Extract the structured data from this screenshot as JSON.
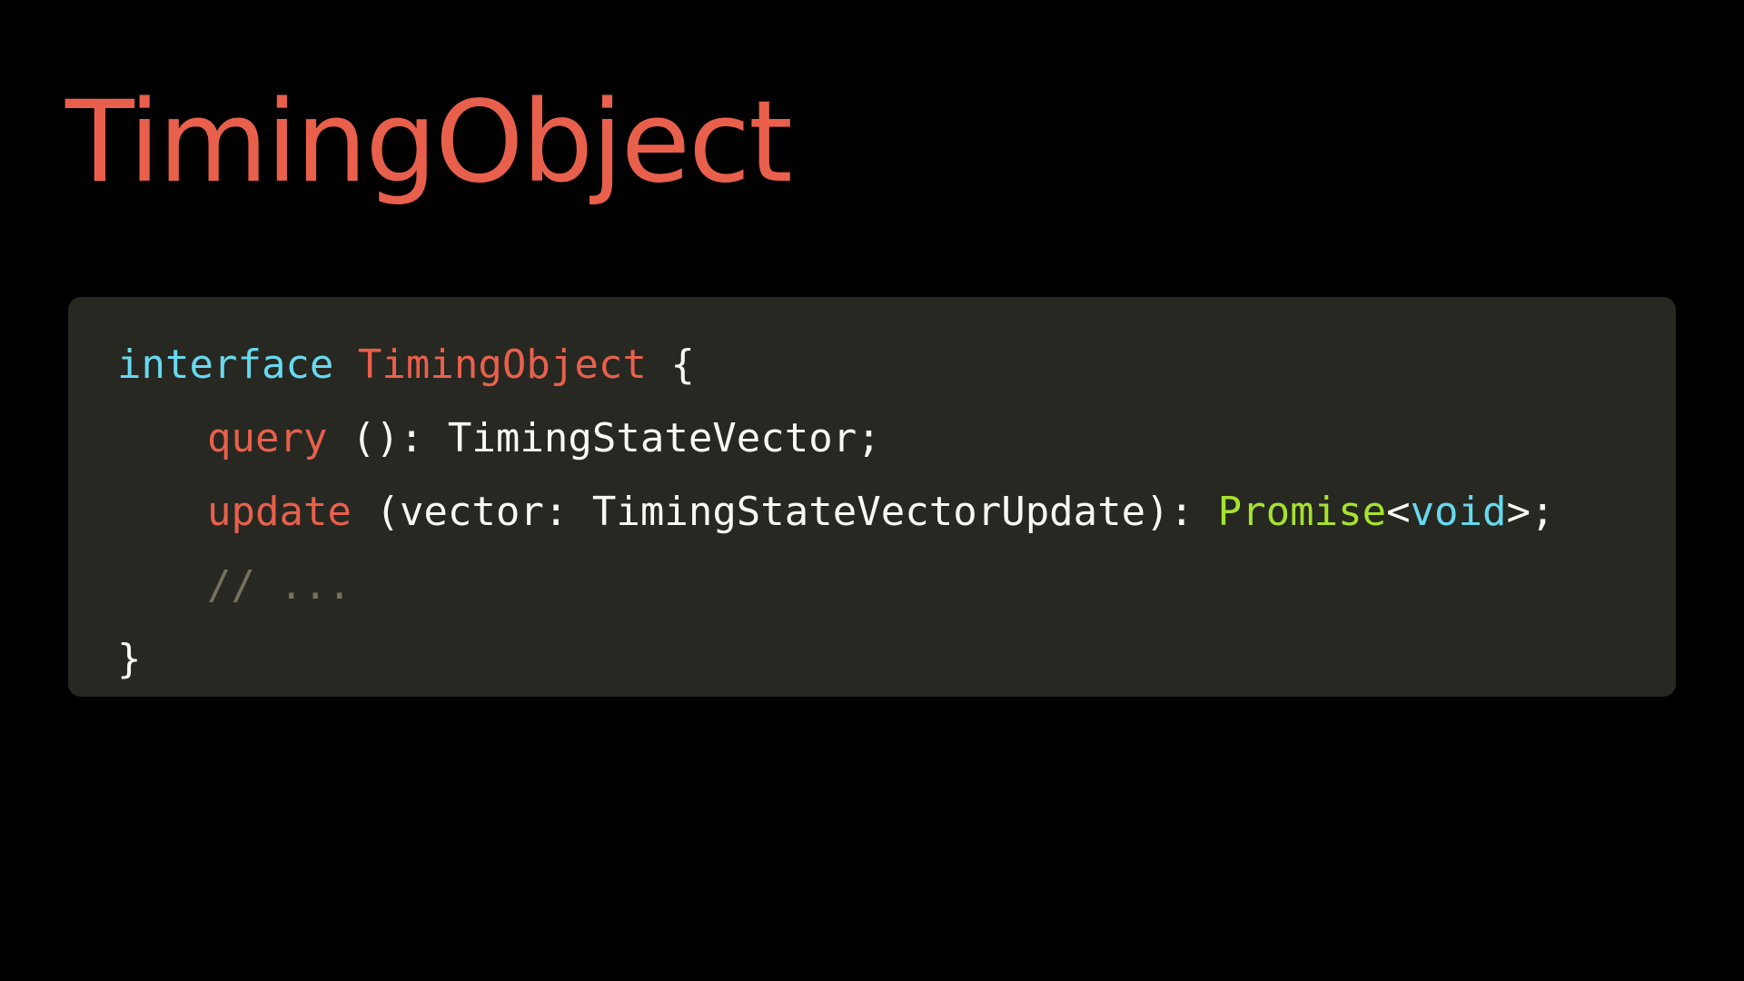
{
  "colors": {
    "background": "#000000",
    "title": "#E8604C",
    "panel_background": "#272822",
    "keyword": "#66D9EF",
    "type_name": "#E8604C",
    "method": "#E8604C",
    "plain": "#F8F8F2",
    "builtin_type": "#A6E22E",
    "comment": "#75715E"
  },
  "slide": {
    "title": "TimingObject"
  },
  "code": {
    "lines": [
      {
        "keyword": "interface",
        "name": "TimingObject",
        "open_brace": "{"
      },
      {
        "method": "query",
        "signature": "(): TimingStateVector;"
      },
      {
        "method": "update",
        "params": "(vector: TimingStateVectorUpdate):",
        "return_type": "Promise",
        "generic_open": "<",
        "generic_arg": "void",
        "generic_close": ">;"
      },
      {
        "comment": "// ..."
      },
      {
        "close_brace": "}"
      }
    ]
  }
}
